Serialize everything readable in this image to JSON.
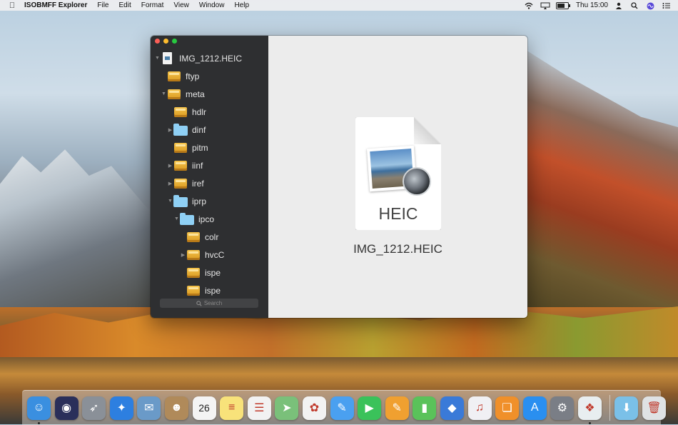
{
  "menubar": {
    "apple": "",
    "app_name": "ISOBMFF Explorer",
    "menus": [
      "File",
      "Edit",
      "Format",
      "View",
      "Window",
      "Help"
    ],
    "clock": "Thu 15:00",
    "status_icons": [
      "wifi-icon",
      "airplay-icon",
      "battery-icon",
      "user-icon",
      "search-icon",
      "siri-icon",
      "notifications-icon"
    ]
  },
  "window": {
    "tree": [
      {
        "label": "IMG_1212.HEIC",
        "icon": "file-icon",
        "depth": 0,
        "disclosure": "expanded"
      },
      {
        "label": "ftyp",
        "icon": "box-icon",
        "depth": 1,
        "disclosure": "none"
      },
      {
        "label": "meta",
        "icon": "box-icon",
        "depth": 1,
        "disclosure": "expanded"
      },
      {
        "label": "hdlr",
        "icon": "box-icon",
        "depth": 2,
        "disclosure": "none"
      },
      {
        "label": "dinf",
        "icon": "folder-icon",
        "depth": 2,
        "disclosure": "collapsed"
      },
      {
        "label": "pitm",
        "icon": "box-icon",
        "depth": 2,
        "disclosure": "none"
      },
      {
        "label": "iinf",
        "icon": "box-icon",
        "depth": 2,
        "disclosure": "collapsed"
      },
      {
        "label": "iref",
        "icon": "box-icon",
        "depth": 2,
        "disclosure": "collapsed"
      },
      {
        "label": "iprp",
        "icon": "folder-icon",
        "depth": 2,
        "disclosure": "expanded"
      },
      {
        "label": "ipco",
        "icon": "folder-icon",
        "depth": 3,
        "disclosure": "expanded"
      },
      {
        "label": "colr",
        "icon": "box-icon",
        "depth": 4,
        "disclosure": "none"
      },
      {
        "label": "hvcC",
        "icon": "box-icon",
        "depth": 4,
        "disclosure": "collapsed"
      },
      {
        "label": "ispe",
        "icon": "box-icon",
        "depth": 4,
        "disclosure": "none"
      },
      {
        "label": "ispe",
        "icon": "box-icon",
        "depth": 4,
        "disclosure": "none"
      }
    ],
    "search_placeholder": "Search",
    "preview": {
      "doc_type": "HEIC",
      "filename": "IMG_1212.HEIC"
    }
  },
  "dock": {
    "apps": [
      {
        "name": "finder-icon",
        "color": "#3a8fe0",
        "glyph": "☺"
      },
      {
        "name": "siri-icon",
        "color": "#2a2f5a",
        "glyph": "◉"
      },
      {
        "name": "launchpad-icon",
        "color": "#8a9098",
        "glyph": "➶"
      },
      {
        "name": "safari-icon",
        "color": "#2d7fe0",
        "glyph": "✦"
      },
      {
        "name": "mail-icon",
        "color": "#6a9ac8",
        "glyph": "✉"
      },
      {
        "name": "contacts-icon",
        "color": "#b08a5a",
        "glyph": "☻"
      },
      {
        "name": "calendar-icon",
        "color": "#f4f4f4",
        "glyph": "26"
      },
      {
        "name": "notes-icon",
        "color": "#f8e27a",
        "glyph": "≡"
      },
      {
        "name": "reminders-icon",
        "color": "#f2f2f2",
        "glyph": "☰"
      },
      {
        "name": "maps-icon",
        "color": "#7ac07a",
        "glyph": "➤"
      },
      {
        "name": "photos-icon",
        "color": "#f2f2f2",
        "glyph": "✿"
      },
      {
        "name": "messages-icon",
        "color": "#4aa0f0",
        "glyph": "✎"
      },
      {
        "name": "facetime-icon",
        "color": "#3ac25a",
        "glyph": "▶"
      },
      {
        "name": "pages-icon",
        "color": "#f0a030",
        "glyph": "✎"
      },
      {
        "name": "numbers-icon",
        "color": "#5ac25a",
        "glyph": "▮"
      },
      {
        "name": "keynote-icon",
        "color": "#3a7ad8",
        "glyph": "◆"
      },
      {
        "name": "itunes-icon",
        "color": "#f0f0f4",
        "glyph": "♫"
      },
      {
        "name": "ibooks-icon",
        "color": "#f0902a",
        "glyph": "❏"
      },
      {
        "name": "app-store-icon",
        "color": "#2a8ff0",
        "glyph": "A"
      },
      {
        "name": "system-preferences-icon",
        "color": "#7a7e86",
        "glyph": "⚙"
      },
      {
        "name": "isobmff-explorer-icon",
        "color": "#e8eef0",
        "glyph": "❖"
      }
    ],
    "trailing": [
      {
        "name": "downloads-folder-icon",
        "color": "#7ac0e8",
        "glyph": "⬇"
      },
      {
        "name": "trash-icon",
        "color": "#dfe2e4",
        "glyph": "🗑"
      }
    ],
    "running": [
      "finder-icon",
      "isobmff-explorer-icon"
    ]
  }
}
